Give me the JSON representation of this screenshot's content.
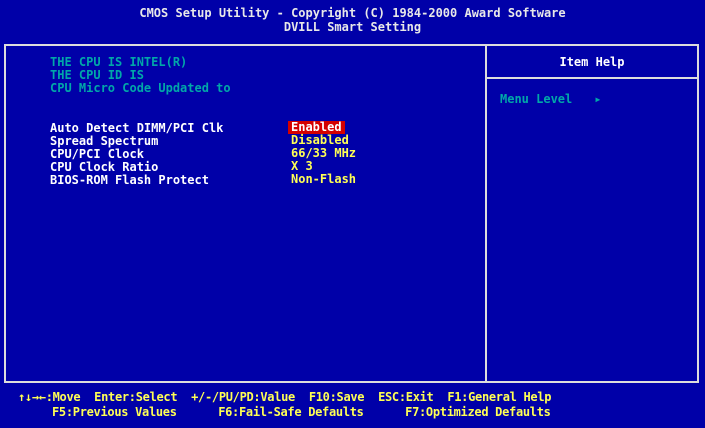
{
  "header": {
    "line1": "CMOS Setup Utility - Copyright (C) 1984-2000 Award Software",
    "line2": "DVILL Smart Setting"
  },
  "info": {
    "cpu_is": "THE CPU IS INTEL(R)",
    "cpu_id": "THE CPU ID IS",
    "microcode": "CPU Micro Code Updated to"
  },
  "settings": [
    {
      "label": "Auto Detect DIMM/PCI Clk",
      "value": "Enabled",
      "selected": true
    },
    {
      "label": "Spread Spectrum",
      "value": "Disabled",
      "selected": false
    },
    {
      "label": "CPU/PCI Clock",
      "value": "66/33 MHz",
      "selected": false
    },
    {
      "label": "CPU Clock Ratio",
      "value": "X 3",
      "selected": false
    },
    {
      "label": "BIOS-ROM Flash Protect",
      "value": "Non-Flash",
      "selected": false
    }
  ],
  "help": {
    "title": "Item Help",
    "menu_level_label": "Menu Level",
    "menu_level_marker": "▸"
  },
  "footer": {
    "line1": "↑↓→←:Move  Enter:Select  +/-/PU/PD:Value  F10:Save  ESC:Exit  F1:General Help",
    "line2": "F5:Previous Values      F6:Fail-Safe Defaults      F7:Optimized Defaults"
  },
  "colors": {
    "background": "#0000a8",
    "info_text": "#00a8a8",
    "value_text": "#ffff54",
    "selected_bg": "#d40000"
  }
}
